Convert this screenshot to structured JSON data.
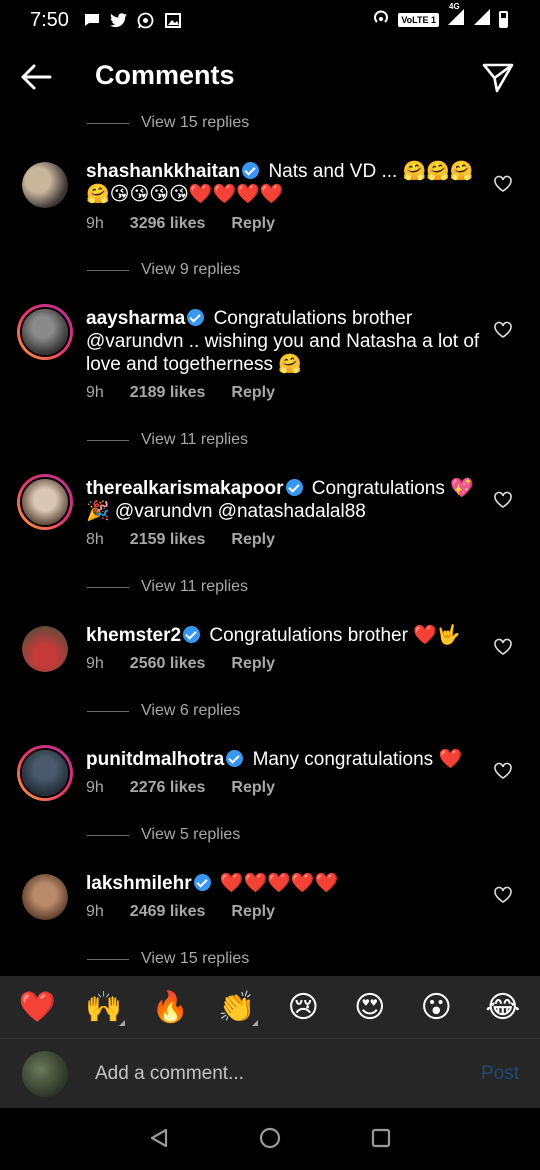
{
  "status_bar": {
    "time": "7:50",
    "network_label": "VoLTE 1",
    "network_type": "4G"
  },
  "header": {
    "title": "Comments",
    "back_icon": "arrow-left-icon",
    "send_icon": "paper-plane-icon"
  },
  "comments": [
    {
      "replies_before": "View 15 replies",
      "username": "shashankkhaitan",
      "verified": true,
      "text": "Nats and VD ... 🤗🤗🤗🤗😘😘😘😘❤️❤️❤️❤️",
      "time": "9h",
      "likes": "3296 likes",
      "reply": "Reply",
      "avatar_colors": [
        "#c9b79c",
        "#3b3533"
      ]
    },
    {
      "replies_before": "View 9 replies",
      "username": "aaysharma",
      "verified": true,
      "text": "Congratulations brother @varundvn .. wishing you and Natasha a lot of love and togetherness 🤗",
      "time": "9h",
      "likes": "2189 likes",
      "reply": "Reply",
      "avatar_colors": [
        "#8a8a8a",
        "#2b2b2b"
      ]
    },
    {
      "replies_before": "View 11 replies",
      "username": "therealkarismakapoor",
      "verified": true,
      "text": "Congratulations 💖🎉 @varundvn @natashadalal88",
      "time": "8h",
      "likes": "2159 likes",
      "reply": "Reply",
      "avatar_colors": [
        "#d9c7b5",
        "#5a4535"
      ]
    },
    {
      "replies_before": "View 11 replies",
      "username": "khemster2",
      "verified": true,
      "text": "Congratulations brother ❤️🤟",
      "time": "9h",
      "likes": "2560 likes",
      "reply": "Reply",
      "avatar_colors": [
        "#c43a3a",
        "#6b4a3a"
      ]
    },
    {
      "replies_before": "View 6 replies",
      "username": "punitdmalhotra",
      "verified": true,
      "text": "Many congratulations ❤️",
      "time": "9h",
      "likes": "2276 likes",
      "reply": "Reply",
      "avatar_colors": [
        "#4a5a6a",
        "#1e2a35"
      ]
    },
    {
      "replies_before": "View 5 replies",
      "username": "lakshmilehr",
      "verified": true,
      "text": "❤️❤️❤️❤️❤️",
      "time": "9h",
      "likes": "2469 likes",
      "reply": "Reply",
      "avatar_colors": [
        "#b98a6a",
        "#5a3a2a"
      ]
    }
  ],
  "trailing_replies": "View 15 replies",
  "reactions": [
    {
      "emoji": "❤️",
      "name": "heart-reaction",
      "more": false
    },
    {
      "emoji": "🙌",
      "name": "raising-hands-reaction",
      "more": true
    },
    {
      "emoji": "🔥",
      "name": "fire-reaction",
      "more": false
    },
    {
      "emoji": "👏",
      "name": "clap-reaction",
      "more": true
    },
    {
      "emoji": "😢",
      "name": "crying-reaction",
      "more": false
    },
    {
      "emoji": "😍",
      "name": "heart-eyes-reaction",
      "more": false
    },
    {
      "emoji": "😮",
      "name": "wow-reaction",
      "more": false
    },
    {
      "emoji": "😂",
      "name": "laughing-reaction",
      "more": false
    }
  ],
  "composer": {
    "placeholder": "Add a comment...",
    "post_label": "Post"
  },
  "colors": {
    "background": "#000000",
    "secondary_text": "#a8a8a8",
    "verified_blue": "#3897f0",
    "bar_bg": "#262626",
    "post_disabled": "#1e4a74"
  }
}
